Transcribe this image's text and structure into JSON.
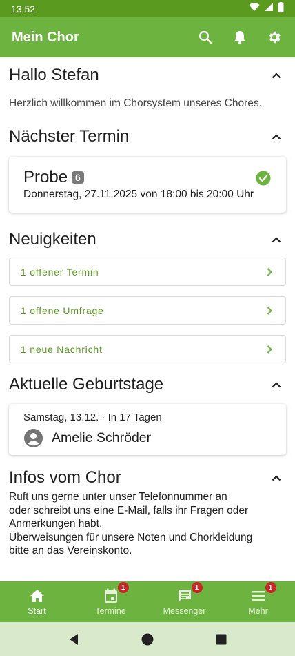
{
  "status_bar": {
    "time": "13:52"
  },
  "app_bar": {
    "title": "Mein Chor",
    "icons": [
      "search-icon",
      "bell-icon",
      "gear-icon"
    ]
  },
  "greeting": {
    "title": "Hallo Stefan",
    "text": "Herzlich willkommen im Chorsystem unseres Chores."
  },
  "next_event": {
    "section_title": "Nächster Termin",
    "title": "Probe",
    "badge": "6",
    "date": "Donnerstag, 27.11.2025 von 18:00 bis 20:00 Uhr",
    "status_icon": "check-circle-icon"
  },
  "news": {
    "section_title": "Neuigkeiten",
    "items": [
      {
        "label": "1 offener Termin"
      },
      {
        "label": "1 offene Umfrage"
      },
      {
        "label": "1 neue Nachricht"
      }
    ]
  },
  "birthdays": {
    "section_title": "Aktuelle Geburtstage",
    "date": "Samstag, 13.12. · In 17 Tagen",
    "name": "Amelie Schröder"
  },
  "info": {
    "section_title": "Infos vom Chor",
    "text_lines": [
      "Ruft uns gerne unter unser Telefonnummer an",
      "oder schreibt uns eine E-Mail, falls ihr Fragen oder",
      "Anmerkungen habt.",
      "Überweisungen für unsere Noten und Chorkleidung",
      "bitte an das Vereinskonto."
    ]
  },
  "bottom_nav": {
    "tabs": [
      {
        "label": "Start",
        "icon": "home-icon",
        "badge": ""
      },
      {
        "label": "Termine",
        "icon": "calendar-icon",
        "badge": "1"
      },
      {
        "label": "Messenger",
        "icon": "chat-icon",
        "badge": "1"
      },
      {
        "label": "Mehr",
        "icon": "menu-icon",
        "badge": "1"
      }
    ]
  },
  "colors": {
    "primary": "#6db33f",
    "status_bar": "#5a9b1f",
    "accent_text": "#5a9b1f",
    "badge": "#c62828",
    "event_badge": "#7a7a7a"
  }
}
